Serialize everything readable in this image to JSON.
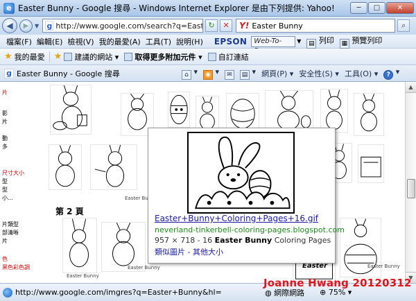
{
  "window": {
    "title": "Easter Bunny - Google 搜尋 - Windows Internet Explorer 是由下列提供: Yahoo!"
  },
  "addressbar": {
    "url": "http://www.google.com/search?q=Easter+Bu",
    "search_value": "Easter Bunny"
  },
  "menubar": {
    "items": [
      "檔案(F)",
      "編輯(E)",
      "檢視(V)",
      "我的最愛(A)",
      "工具(T)",
      "說明(H)"
    ],
    "brand": "EPSON",
    "webtopage": "Web-To-Page",
    "print": "列印",
    "preview": "預覽列印"
  },
  "favbar": {
    "favorites": "我的最愛",
    "suggested": "建議的網站",
    "more_addons": "取得更多附加元件",
    "custom_links": "自訂連結"
  },
  "tab": {
    "title": "Easter Bunny - Google 搜尋",
    "commands": [
      "網頁(P)",
      "安全性(S)",
      "工具(O)"
    ]
  },
  "leftnav": {
    "items": [
      {
        "text": "片",
        "red": true
      },
      {
        "text": "",
        "red": false
      },
      {
        "text": "影",
        "red": false
      },
      {
        "text": "片",
        "red": false
      },
      {
        "text": "",
        "red": false
      },
      {
        "text": "動",
        "red": false
      },
      {
        "text": "多",
        "red": false
      },
      {
        "text": "",
        "red": false
      },
      {
        "text": "尺寸大小",
        "red": true
      },
      {
        "text": "型",
        "red": false
      },
      {
        "text": "型",
        "red": false
      },
      {
        "text": "小...",
        "red": false
      },
      {
        "text": "",
        "red": false
      },
      {
        "text": "片類型",
        "red": false
      },
      {
        "text": "部清晰",
        "red": false
      },
      {
        "text": "片",
        "red": false
      },
      {
        "text": "",
        "red": false
      },
      {
        "text": "色",
        "red": true
      },
      {
        "text": "黑色彩色調",
        "red": true
      }
    ]
  },
  "results": {
    "page_label": "第 2 頁",
    "captions": [
      "Easter Bunny",
      "Easter Bunny",
      "Easter Bunny",
      "Easter Bunny"
    ],
    "easter_label": "Easter"
  },
  "popup": {
    "title": "Easter+Bunny+Coloring+Pages+16.gif",
    "site": "neverland-tinkerbell-coloring-pages.blogspot.com",
    "desc_prefix": "957 × 718 - 16",
    "desc_bold": "Easter Bunny",
    "desc_suffix": "Coloring Pages",
    "link_similar": "類似圖片",
    "link_sep": " - ",
    "link_sizes": "其他大小"
  },
  "statusbar": {
    "status": "http://www.google.com/imgres?q=Easter+Bunny&hl=",
    "zone": "網際網路",
    "zoom": "75%"
  },
  "watermark": "Joanne Hwang 20120312"
}
